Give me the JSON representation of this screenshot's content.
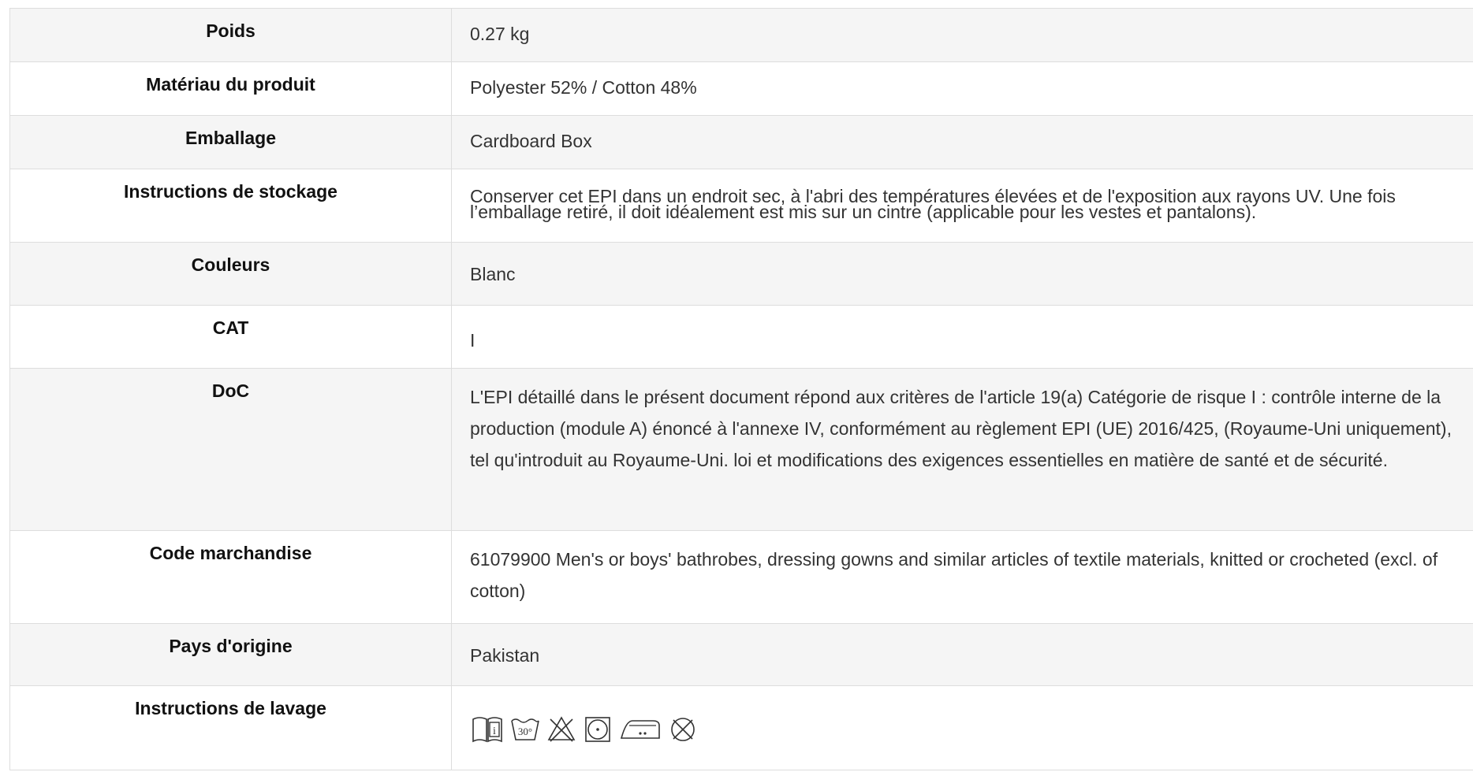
{
  "rows": [
    {
      "label": "Poids",
      "value": "0.27 kg"
    },
    {
      "label": "Matériau du produit",
      "value": "Polyester 52% / Cotton 48%"
    },
    {
      "label": "Emballage",
      "value": "Cardboard Box"
    },
    {
      "label": "Instructions de stockage",
      "value": "Conserver cet EPI dans un endroit sec, à l'abri des températures élevées et de l'exposition aux rayons UV. Une fois l’emballage retiré, il doit idéalement est mis sur un cintre (applicable pour les vestes et pantalons)."
    },
    {
      "label": "Couleurs",
      "value": "Blanc"
    },
    {
      "label": "CAT",
      "value": "I"
    },
    {
      "label": "DoC",
      "value": "L'EPI détaillé dans le présent document répond aux critères de l'article 19(a) Catégorie de risque I : contrôle interne de la production (module A) énoncé à l'annexe IV, conformément au règlement EPI (UE) 2016/425, (Royaume-Uni uniquement), tel qu'introduit au Royaume-Uni. loi et modifications des exigences essentielles en matière de santé et de sécurité."
    },
    {
      "label": "Code marchandise",
      "value": "61079900 Men's or boys' bathrobes, dressing gowns and similar articles of textile materials, knitted or crocheted (excl. of cotton)"
    },
    {
      "label": "Pays d'origine",
      "value": "Pakistan"
    },
    {
      "label": "Instructions de lavage",
      "care_icons": [
        "read-instructions-icon",
        "wash-30-icon",
        "do-not-bleach-icon",
        "tumble-dry-low-icon",
        "iron-low-icon",
        "do-not-dry-clean-icon"
      ],
      "wash_temp": "30°"
    }
  ]
}
